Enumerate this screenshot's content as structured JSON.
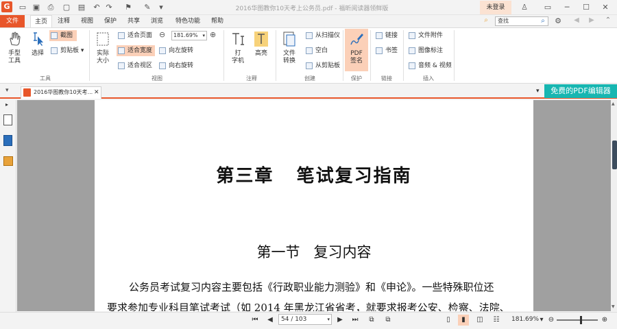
{
  "titlebar": {
    "logo": "G",
    "title": "2016华图教你10天考上公务员.pdf - 福昕阅读器领鲜版",
    "login": "未登录",
    "minimize": "─",
    "maximize": "☐",
    "close": "✕"
  },
  "menu": {
    "file": "文件",
    "tabs": [
      "主页",
      "注释",
      "视图",
      "保护",
      "共享",
      "浏览",
      "特色功能",
      "帮助"
    ],
    "search_placeholder": "查找"
  },
  "ribbon": {
    "tools": {
      "hand": "手型\n工具",
      "select": "选择",
      "screenshot": "截图",
      "clipboard": "剪贴板",
      "label": "工具"
    },
    "view": {
      "actual_size": "实际\n大小",
      "fit_page": "适合页面",
      "fit_width": "适合宽度",
      "fit_visible": "适合视区",
      "zoom_value": "181.69%",
      "rotate_left": "向左旋转",
      "rotate_right": "向右旋转",
      "label": "视图"
    },
    "annotate": {
      "typewriter": "打\n字机",
      "highlight": "高亮",
      "label": "注释"
    },
    "create": {
      "convert": "文件\n转换",
      "from_scanner": "从扫描仪",
      "blank": "空白",
      "from_clipboard": "从剪贴板",
      "label": "创建"
    },
    "protect": {
      "sign": "PDF\n签名",
      "label": "保护"
    },
    "links": {
      "link": "链接",
      "bookmark": "书签",
      "label": "链接"
    },
    "insert": {
      "attachment": "文件附件",
      "image_annot": "图像标注",
      "audio_video": "音频 & 视频",
      "label": "插入"
    }
  },
  "document": {
    "tab_title": "2016华图教你10天考...",
    "promo": "免费的PDF编辑器",
    "chapter_title": "第三章   笔试复习指南",
    "section_title": "第一节   复习内容",
    "para1": "公务员考试复习内容主要包括《行政职业能力测验》和《申论》。一些特殊职位还",
    "para2": "要求参加专业科目笔试考试（如 2014 年黑龙江省省考，就要求报考公安、检察、法院、"
  },
  "status": {
    "page_indicator": "54 / 103",
    "zoom": "181.69%"
  },
  "colors": {
    "accent": "#e8562a",
    "promo": "#17b6b1",
    "highlight": "#fbd0b8"
  }
}
